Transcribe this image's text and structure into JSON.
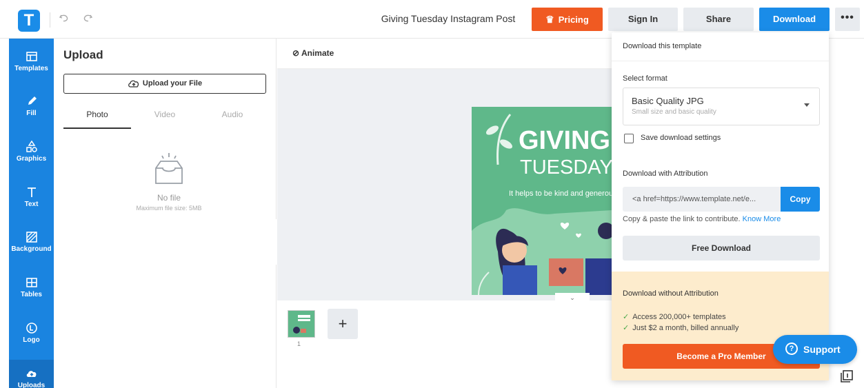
{
  "topbar": {
    "logo_letter": "T",
    "undo_icon": "undo-icon",
    "redo_icon": "redo-icon",
    "title": "Giving Tuesday Instagram Post",
    "pricing_label": "Pricing",
    "signin_label": "Sign In",
    "share_label": "Share",
    "download_label": "Download",
    "more_label": "•••"
  },
  "sidebar": {
    "items": [
      {
        "label": "Templates",
        "icon": "templates-icon"
      },
      {
        "label": "Fill",
        "icon": "pencil-icon"
      },
      {
        "label": "Graphics",
        "icon": "shapes-icon"
      },
      {
        "label": "Text",
        "icon": "text-icon"
      },
      {
        "label": "Background",
        "icon": "background-icon"
      },
      {
        "label": "Tables",
        "icon": "table-icon"
      },
      {
        "label": "Logo",
        "icon": "logo-icon"
      },
      {
        "label": "Uploads",
        "icon": "cloud-upload-icon"
      }
    ]
  },
  "panel": {
    "title": "Upload",
    "upload_button": "Upload your File",
    "tabs": [
      "Photo",
      "Video",
      "Audio"
    ],
    "empty_title": "No file",
    "empty_sub": "Maximum file size: 5MB"
  },
  "canvas": {
    "animate_label": "Animate",
    "art_giving": "GIVING",
    "art_tuesday": "TUESDAY",
    "art_tagline": "It helps to be kind and generous",
    "page_number": "1",
    "add_page": "+"
  },
  "download_menu": {
    "header": "Download this template",
    "format_label": "Select format",
    "format_value": "Basic Quality JPG",
    "format_sub": "Small size and basic quality",
    "save_settings": "Save download settings",
    "attribution_label": "Download with Attribution",
    "attribution_value": "<a href=https://www.template.net/e...",
    "copy_label": "Copy",
    "hint_text": "Copy & paste the link to contribute.",
    "hint_link": "Know More",
    "free_download": "Free Download",
    "pro_title": "Download without Attribution",
    "pro_items": [
      "Access 200,000+ templates",
      "Just $2 a month, billed annually"
    ],
    "pro_button": "Become a Pro Member"
  },
  "support": {
    "label": "Support"
  },
  "colors": {
    "accent_blue": "#1a8ce8",
    "pricing_orange": "#f05a22",
    "art_green": "#5fb88a",
    "pro_bg": "#fdeccd"
  }
}
